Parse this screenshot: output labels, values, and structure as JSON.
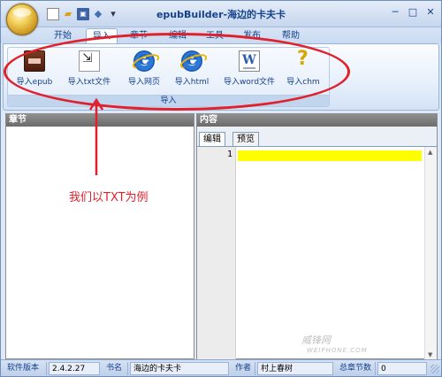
{
  "window": {
    "title": "epubBuilder-海边的卡夫卡"
  },
  "window_controls": {
    "minimize": "─",
    "restore": "□",
    "close": "✕"
  },
  "quick_access": {
    "new": "",
    "open": "▰",
    "save": "▣",
    "undo": "◆",
    "customize": "▾"
  },
  "tabs": [
    {
      "label": "开始",
      "active": false
    },
    {
      "label": "导入",
      "active": true
    },
    {
      "label": "章节",
      "active": false
    },
    {
      "label": "编辑",
      "active": false
    },
    {
      "label": "工具",
      "active": false
    },
    {
      "label": "发布",
      "active": false
    },
    {
      "label": "帮助",
      "active": false
    }
  ],
  "ribbon": {
    "group_label": "导入",
    "buttons": [
      {
        "label": "导入epub",
        "icon": "epub-icon"
      },
      {
        "label": "导入txt文件",
        "icon": "txt-import-icon"
      },
      {
        "label": "导入网页",
        "icon": "ie-icon"
      },
      {
        "label": "导入html",
        "icon": "ie-icon"
      },
      {
        "label": "导入word文件",
        "icon": "word-icon"
      },
      {
        "label": "导入chm",
        "icon": "chm-icon"
      }
    ]
  },
  "annotation": {
    "text": "我们以TXT为例",
    "color": "#e0202a"
  },
  "chapter_panel": {
    "title": "章节"
  },
  "content_panel": {
    "title": "内容",
    "tabs": [
      {
        "label": "编辑",
        "active": true
      },
      {
        "label": "预览",
        "active": false
      }
    ],
    "line_number": "1",
    "highlight_color": "#ffff00"
  },
  "watermark": {
    "text": "威锋网",
    "sub": "WEIPHONE.COM"
  },
  "statusbar": {
    "version_label": "软件版本",
    "version_value": "2.4.2.27",
    "book_label": "书名",
    "book_value": "海边的卡夫卡",
    "author_label": "作者",
    "author_value": "村上春树",
    "chapters_label": "总章节数",
    "chapters_value": "0"
  },
  "colors": {
    "accent": "#15428b",
    "ribbon_border": "#99b3d8",
    "panel_header": "#7a7a7a"
  }
}
